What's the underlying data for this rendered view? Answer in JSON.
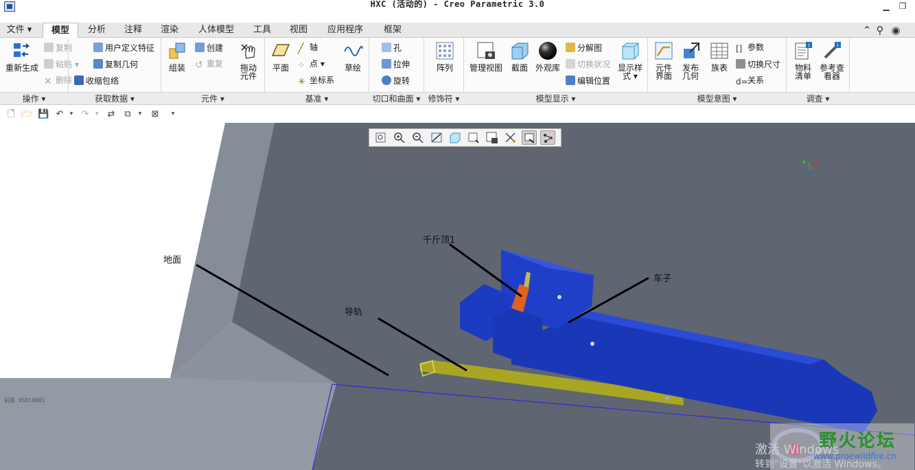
{
  "window": {
    "title": "HXC (活动的) - Creo Parametric 3.0",
    "minimize": "▁",
    "restore": "❐",
    "close": "✕"
  },
  "tabs": [
    {
      "label": "文件 ▾"
    },
    {
      "label": "模型"
    },
    {
      "label": "分析"
    },
    {
      "label": "注释"
    },
    {
      "label": "渲染"
    },
    {
      "label": "人体模型"
    },
    {
      "label": "工具"
    },
    {
      "label": "视图"
    },
    {
      "label": "应用程序"
    },
    {
      "label": "框架"
    }
  ],
  "ribbon": {
    "operations": {
      "regenerate": "重新生成",
      "copy": "复制",
      "paste": "粘贴 ▾",
      "delete": "删除 ▾",
      "group": "操作 ▾"
    },
    "get_data": {
      "udf": "用户定义特征",
      "copy_geom": "复制几何",
      "shrinkwrap": "收缩包络",
      "group": "获取数据 ▾"
    },
    "component": {
      "assemble": "组装",
      "create": "创建",
      "repeat": "重复",
      "drag_line1": "拖动",
      "drag_line2": "元件",
      "group": "元件 ▾"
    },
    "datum": {
      "plane": "平面",
      "axis": "轴",
      "point": "点 ▾",
      "csys": "坐标系",
      "sketch": "草绘",
      "group": "基准 ▾"
    },
    "cut_surface": {
      "hole": "孔",
      "extrude": "拉伸",
      "revolve": "旋转",
      "group": "切口和曲面 ▾"
    },
    "modifier": {
      "pattern": "阵列",
      "group": "修饰符 ▾"
    },
    "model_display": {
      "manage_views": "管理视图",
      "section": "截面",
      "appearance": "外观库",
      "exploded": "分解图",
      "toggle_status": "切换状况",
      "edit_position": "编辑位置",
      "display_style_1": "显示样",
      "display_style_2": "式 ▾",
      "group": "模型显示 ▾"
    },
    "model_intent": {
      "comp_iface_1": "元件",
      "comp_iface_2": "界面",
      "publish_1": "发布",
      "publish_2": "几何",
      "family_table": "族表",
      "params": "参数",
      "switch_dims": "切换尺寸",
      "relations": "关系",
      "group": "模型意图 ▾"
    },
    "investigate": {
      "bom_1": "物料",
      "bom_2": "清单",
      "ref_1": "参考查",
      "ref_2": "看器",
      "group": "调查 ▾"
    }
  },
  "annotations": {
    "ground": "地面",
    "rail": "导轨",
    "jack": "千斤顶1",
    "car": "车子"
  },
  "section_label": "前面 XSEC0001",
  "watermark": {
    "forum": "野火论坛",
    "url": "www.proewildfire.cn"
  },
  "activation": {
    "line1": "激活 Windows",
    "line2": "转到\"设置\"以激活 Windows。"
  },
  "colors": {
    "ribbon_bg": "#fbfbfb",
    "viewport_bg": "#5f6671",
    "body_blue": "#1a37b8",
    "rail_yellow": "#a9a623",
    "jack_orange": "#e0621f"
  }
}
